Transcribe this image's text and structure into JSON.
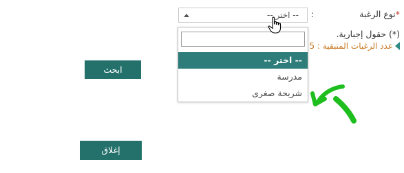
{
  "form": {
    "desire_type_label": "نوع الرغبة",
    "required_marker": "*",
    "colon": ":",
    "select_value": "-- اختر --",
    "mandatory_note": "(*) حقول إجبارية.",
    "remaining_label": "عدد الرغبات المتبقية : 5"
  },
  "dropdown": {
    "search_value": "",
    "options": [
      "-- اختر --",
      "مدرسة",
      "شريحة صغرى"
    ],
    "selected_index": 0
  },
  "buttons": {
    "search": "ابحث",
    "close": "إغلاق"
  },
  "colors": {
    "accent": "#24716c",
    "selected_option": "#2e7d7b",
    "remaining_text": "#c87922",
    "annotation": "#1fbe1f"
  },
  "icons": [
    "mouse-pointer-icon",
    "sort-caret-icon",
    "triangle-bullet-icon",
    "annotation-arrow-icon"
  ]
}
